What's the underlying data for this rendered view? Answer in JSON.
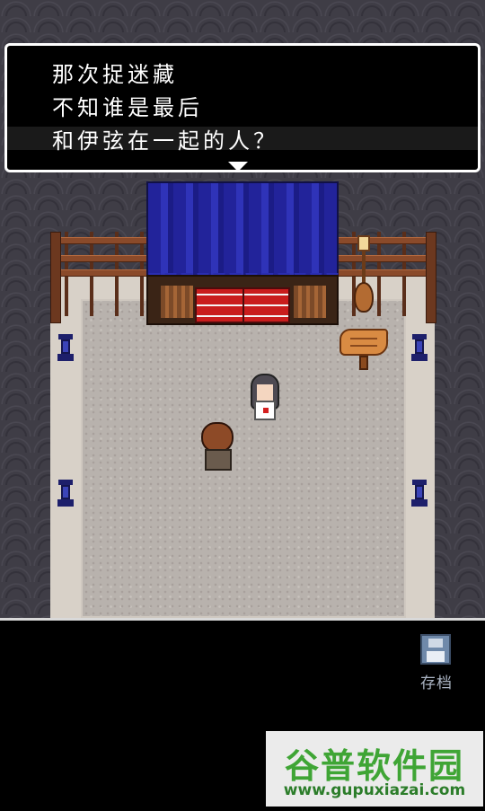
{
  "dialog": {
    "lines": [
      "那次捉迷藏",
      "不知谁是最后",
      "和伊弦在一起的人？"
    ]
  },
  "menu": {
    "save_label": "存档"
  },
  "watermark": {
    "title": "谷普软件园",
    "url": "www.gupuxiazai.com"
  },
  "colors": {
    "stall_roof": "#2f33b8",
    "counter_red": "#c91d1d",
    "dialog_border": "#ffffff",
    "watermark_green": "#3fa535"
  },
  "icons": {
    "save": "floppy-disk-icon",
    "next": "triangle-down-icon"
  }
}
